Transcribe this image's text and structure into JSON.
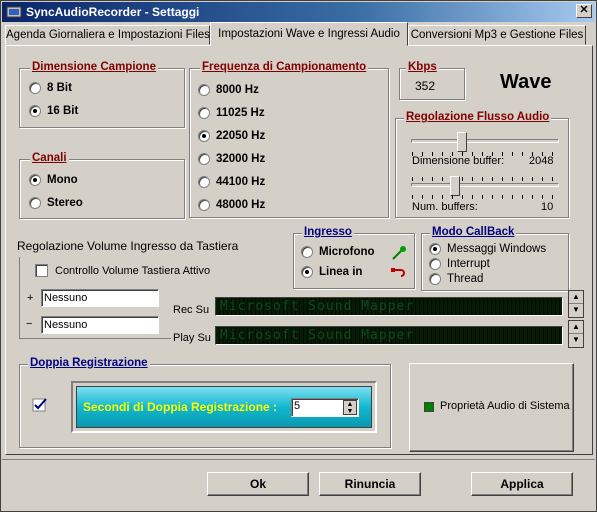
{
  "window": {
    "title": "SyncAudioRecorder - Settaggi",
    "close_label": "✕"
  },
  "tabs": [
    {
      "label": "Agenda Giornaliera e Impostazioni Files"
    },
    {
      "label": "Impostazioni Wave e Ingressi Audio"
    },
    {
      "label": "Conversioni Mp3 e Gestione Files"
    }
  ],
  "dimensione_campione": {
    "legend": "Dimensione Campione",
    "options": [
      {
        "label": "8 Bit",
        "selected": false
      },
      {
        "label": "16 Bit",
        "selected": true
      }
    ]
  },
  "canali": {
    "legend": "Canali",
    "options": [
      {
        "label": "Mono",
        "selected": true
      },
      {
        "label": "Stereo",
        "selected": false
      }
    ]
  },
  "frequenza": {
    "legend": "Frequenza di Campionamento",
    "options": [
      {
        "label": "8000 Hz",
        "selected": false
      },
      {
        "label": "11025 Hz",
        "selected": false
      },
      {
        "label": "22050 Hz",
        "selected": true
      },
      {
        "label": "32000 Hz",
        "selected": false
      },
      {
        "label": "44100 Hz",
        "selected": false
      },
      {
        "label": "48000 Hz",
        "selected": false
      }
    ]
  },
  "kbps": {
    "legend": "Kbps",
    "value": "352"
  },
  "format_label": "Wave",
  "flusso": {
    "legend": "Regolazione Flusso Audio",
    "buffer_label": "Dimensione buffer:",
    "buffer_value": "2048",
    "num_label": "Num. buffers:",
    "num_value": "10"
  },
  "volume": {
    "title": "Regolazione Volume Ingresso da Tastiera",
    "checkbox_label": "Controllo Volume Tastiera Attivo",
    "plus_label": "+",
    "minus_label": "−",
    "plus_value": "Nessuno",
    "minus_value": "Nessuno"
  },
  "ingresso": {
    "legend": "Ingresso",
    "options": [
      {
        "label": "Microfono",
        "selected": false
      },
      {
        "label": "Linea in",
        "selected": true
      }
    ]
  },
  "callback": {
    "legend": "Modo CallBack",
    "options": [
      {
        "label": "Messaggi Windows",
        "selected": true
      },
      {
        "label": "Interrupt",
        "selected": false
      },
      {
        "label": "Thread",
        "selected": false
      }
    ]
  },
  "devices": {
    "rec_label": "Rec Su",
    "rec_value": "Microsoft Sound Mapper",
    "play_label": "Play Su",
    "play_value": "Microsoft Sound Mapper"
  },
  "doppia": {
    "legend": "Doppia Registrazione",
    "seconds_label": "Secondi di Doppia Registrazione :",
    "seconds_value": "5"
  },
  "system_audio_button": "Proprietà Audio di Sistema",
  "buttons": {
    "ok": "Ok",
    "cancel": "Rinuncia",
    "apply": "Applica"
  },
  "colors": {
    "legend_red": "#800000",
    "legend_blue": "#000080",
    "titlebar": "#0a246a",
    "cyan": "#10b8d0"
  }
}
